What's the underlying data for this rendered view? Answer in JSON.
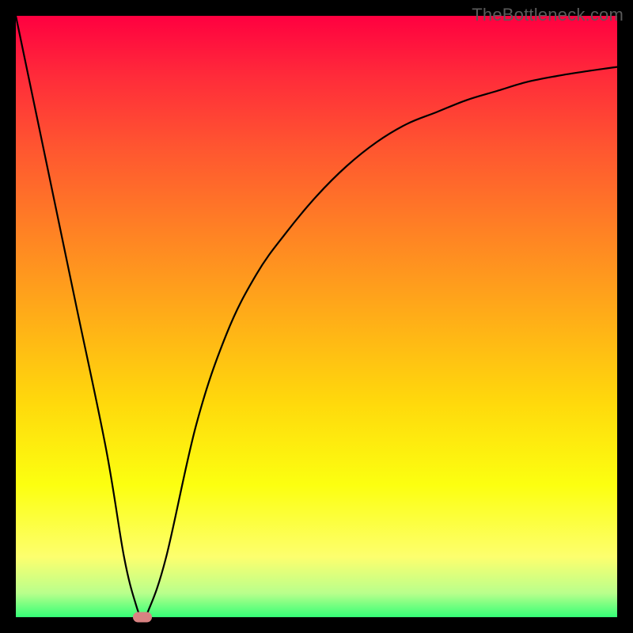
{
  "watermark": "TheBottleneck.com",
  "chart_data": {
    "type": "line",
    "title": "",
    "xlabel": "",
    "ylabel": "",
    "xlim": [
      0,
      100
    ],
    "ylim": [
      0,
      100
    ],
    "grid": false,
    "series": [
      {
        "name": "bottleneck-curve",
        "x": [
          0,
          5,
          10,
          15,
          18,
          20,
          21,
          22,
          25,
          30,
          35,
          40,
          45,
          50,
          55,
          60,
          65,
          70,
          75,
          80,
          85,
          90,
          95,
          100
        ],
        "values": [
          100,
          76,
          52,
          28,
          10,
          2,
          0,
          1,
          10,
          32,
          47,
          57,
          64,
          70,
          75,
          79,
          82,
          84,
          86,
          87.5,
          89,
          90,
          90.8,
          91.5
        ]
      }
    ],
    "marker": {
      "x": 21,
      "y": 0,
      "name": "optimal-point"
    },
    "background": {
      "type": "vertical-gradient",
      "stops": [
        {
          "pos": 0.0,
          "color": "#ff0040"
        },
        {
          "pos": 0.5,
          "color": "#ffad18"
        },
        {
          "pos": 0.78,
          "color": "#fcff10"
        },
        {
          "pos": 1.0,
          "color": "#34ff76"
        }
      ]
    }
  }
}
